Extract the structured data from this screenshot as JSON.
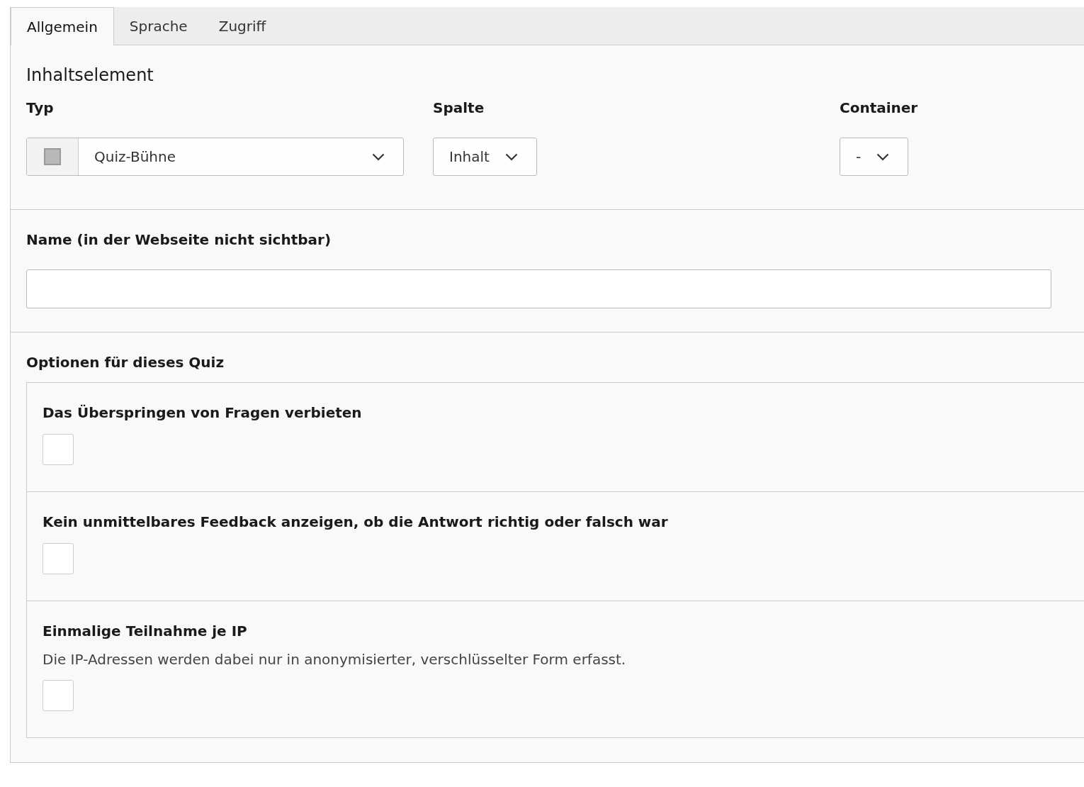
{
  "tabs": [
    {
      "label": "Allgemein",
      "selected": true
    },
    {
      "label": "Sprache",
      "selected": false
    },
    {
      "label": "Zugriff",
      "selected": false
    }
  ],
  "section_title": "Inhaltselement",
  "selects": [
    {
      "label": "Typ",
      "value": "Quiz-Bühne",
      "has_icon": true
    },
    {
      "label": "Spalte",
      "value": "Inhalt",
      "has_icon": false
    },
    {
      "label": "Container",
      "value": "-",
      "has_icon": false
    }
  ],
  "name_field": {
    "label": "Name (in der Webseite nicht sichtbar)"
  },
  "options": {
    "title": "Optionen für dieses Quiz",
    "items": [
      {
        "label": "Das Überspringen von Fragen verbieten",
        "checked": false
      },
      {
        "label": "Kein unmittelbares Feedback anzeigen, ob die Antwort richtig oder falsch war",
        "checked": false
      },
      {
        "label": "Einmalige Teilnahme je IP",
        "description": "Die IP-Adressen werden dabei nur in anonymisierter, verschlüsselter Form erfasst.",
        "checked": false
      }
    ]
  }
}
